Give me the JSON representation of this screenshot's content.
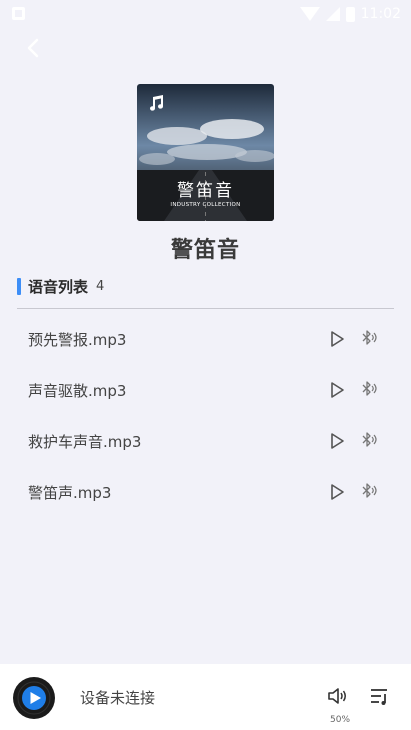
{
  "status_bar": {
    "time": "11:02"
  },
  "album": {
    "title": "警笛音",
    "cover_title": "警笛音",
    "cover_subtitle": "INDUSTRY COLLECTION"
  },
  "list": {
    "label": "语音列表",
    "count": "4",
    "tracks": [
      {
        "name": "预先警报.mp3"
      },
      {
        "name": "声音驱散.mp3"
      },
      {
        "name": "救护车声音.mp3"
      },
      {
        "name": "警笛声.mp3"
      }
    ]
  },
  "player": {
    "status": "设备未连接",
    "volume_label": "50%"
  },
  "colors": {
    "accent": "#3d8ef7",
    "background": "#f2f2f9"
  }
}
